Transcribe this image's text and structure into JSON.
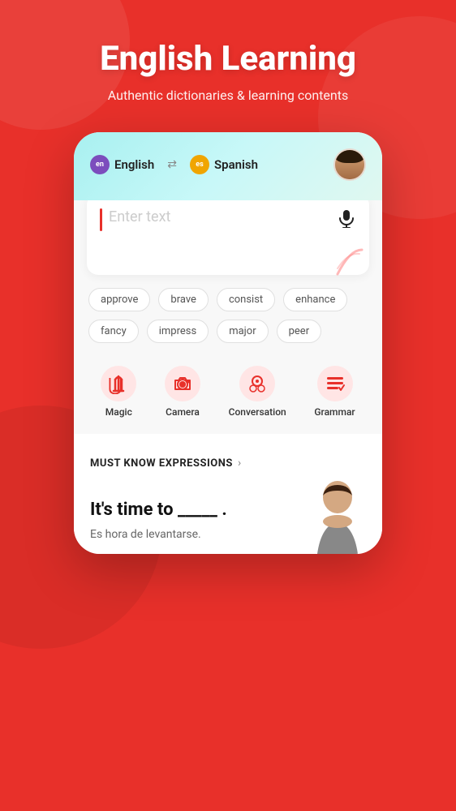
{
  "hero": {
    "title": "English Learning",
    "subtitle": "Authentic dictionaries & learning contents"
  },
  "translator": {
    "lang_from": {
      "code": "en",
      "label": "English",
      "badge_text": "en"
    },
    "lang_to": {
      "code": "es",
      "label": "Spanish",
      "badge_text": "es"
    },
    "search_placeholder": "Enter text"
  },
  "word_chips": [
    "approve",
    "brave",
    "consist",
    "enhance",
    "fancy",
    "impress",
    "major",
    "peer"
  ],
  "nav_items": [
    {
      "id": "magic",
      "label": "Magic"
    },
    {
      "id": "camera",
      "label": "Camera"
    },
    {
      "id": "conversation",
      "label": "Conversation"
    },
    {
      "id": "grammar",
      "label": "Grammar"
    }
  ],
  "must_know": {
    "section_title": "MUST KNOW EXPRESSIONS",
    "expression_en": "It's time to _____ .",
    "expression_es": "Es hora de levantarse."
  },
  "colors": {
    "primary_red": "#e8302a",
    "accent_purple": "#7c4dbd",
    "accent_yellow": "#f0a500"
  }
}
